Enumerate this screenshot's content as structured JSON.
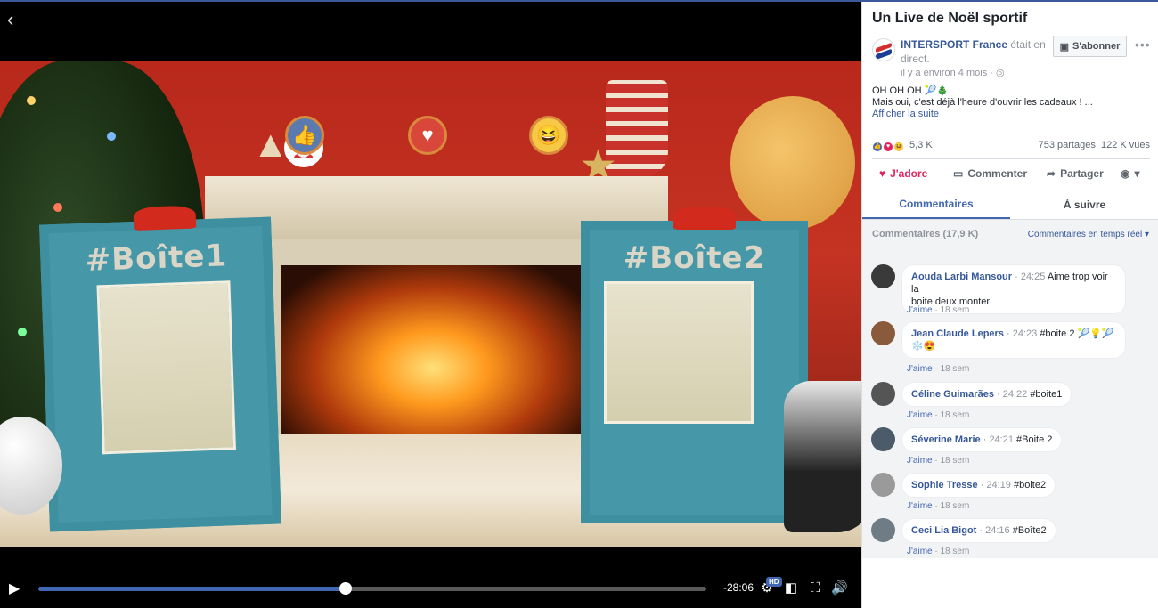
{
  "video": {
    "back_icon": "chevron-left-icon",
    "box1_label": "#Boîte1",
    "box2_label": "#Boîte2",
    "time_remaining": "-28:06",
    "progress_fraction": 0.46,
    "hd_badge": "HD"
  },
  "post": {
    "title": "Un Live de Noël sportif",
    "author": "INTERSPORT France",
    "author_suffix": "était en direct.",
    "time_ago": "il y a environ 4 mois",
    "subscribe_label": "S'abonner",
    "text_line1": "OH OH OH 🎾🎄",
    "text_line2": "Mais oui, c'est déjà l'heure d'ouvrir les cadeaux ! ...",
    "see_more": "Afficher la suite",
    "reactions_count": "5,3 K",
    "shares": "753 partages",
    "views": "122 K vues"
  },
  "actions": {
    "love_label": "J'adore",
    "comment_label": "Commenter",
    "share_label": "Partager"
  },
  "tabs": {
    "comments": "Commentaires",
    "follow": "À suivre"
  },
  "comments_header": {
    "count_label": "Commentaires (17,9 K)",
    "order_label": "Commentaires en temps réel"
  },
  "comments": [
    {
      "name": "Aouda Larbi Mansour",
      "time": "24:25",
      "text": "Aime trop voir la",
      "text2": "boite deux monter",
      "like": "J'aime",
      "age": "18 sem",
      "avatar_color": "#3a3a3a"
    },
    {
      "name": "Jean Claude Lepers",
      "time": "24:23",
      "text": "#boite 2 🎾💡🎾",
      "text2": "❄️😍",
      "like": "J'aime",
      "age": "18 sem",
      "avatar_color": "#8a5a3c"
    },
    {
      "name": "Céline Guimarães",
      "time": "24:22",
      "text": "#boite1",
      "text2": "",
      "like": "J'aime",
      "age": "18 sem",
      "avatar_color": "#555"
    },
    {
      "name": "Séverine Marie",
      "time": "24:21",
      "text": "#Boite 2",
      "text2": "",
      "like": "J'aime",
      "age": "18 sem",
      "avatar_color": "#4b5b6a"
    },
    {
      "name": "Sophie Tresse",
      "time": "24:19",
      "text": "#boite2",
      "text2": "",
      "like": "J'aime",
      "age": "18 sem",
      "avatar_color": "#9a9a9a"
    },
    {
      "name": "Ceci Lia Bigot",
      "time": "24:16",
      "text": "#Boîte2",
      "text2": "",
      "like": "J'aime",
      "age": "18 sem",
      "avatar_color": "#6f7c86"
    }
  ],
  "colors": {
    "accent": "#4267b2",
    "link": "#365899",
    "love": "#e0245e"
  }
}
